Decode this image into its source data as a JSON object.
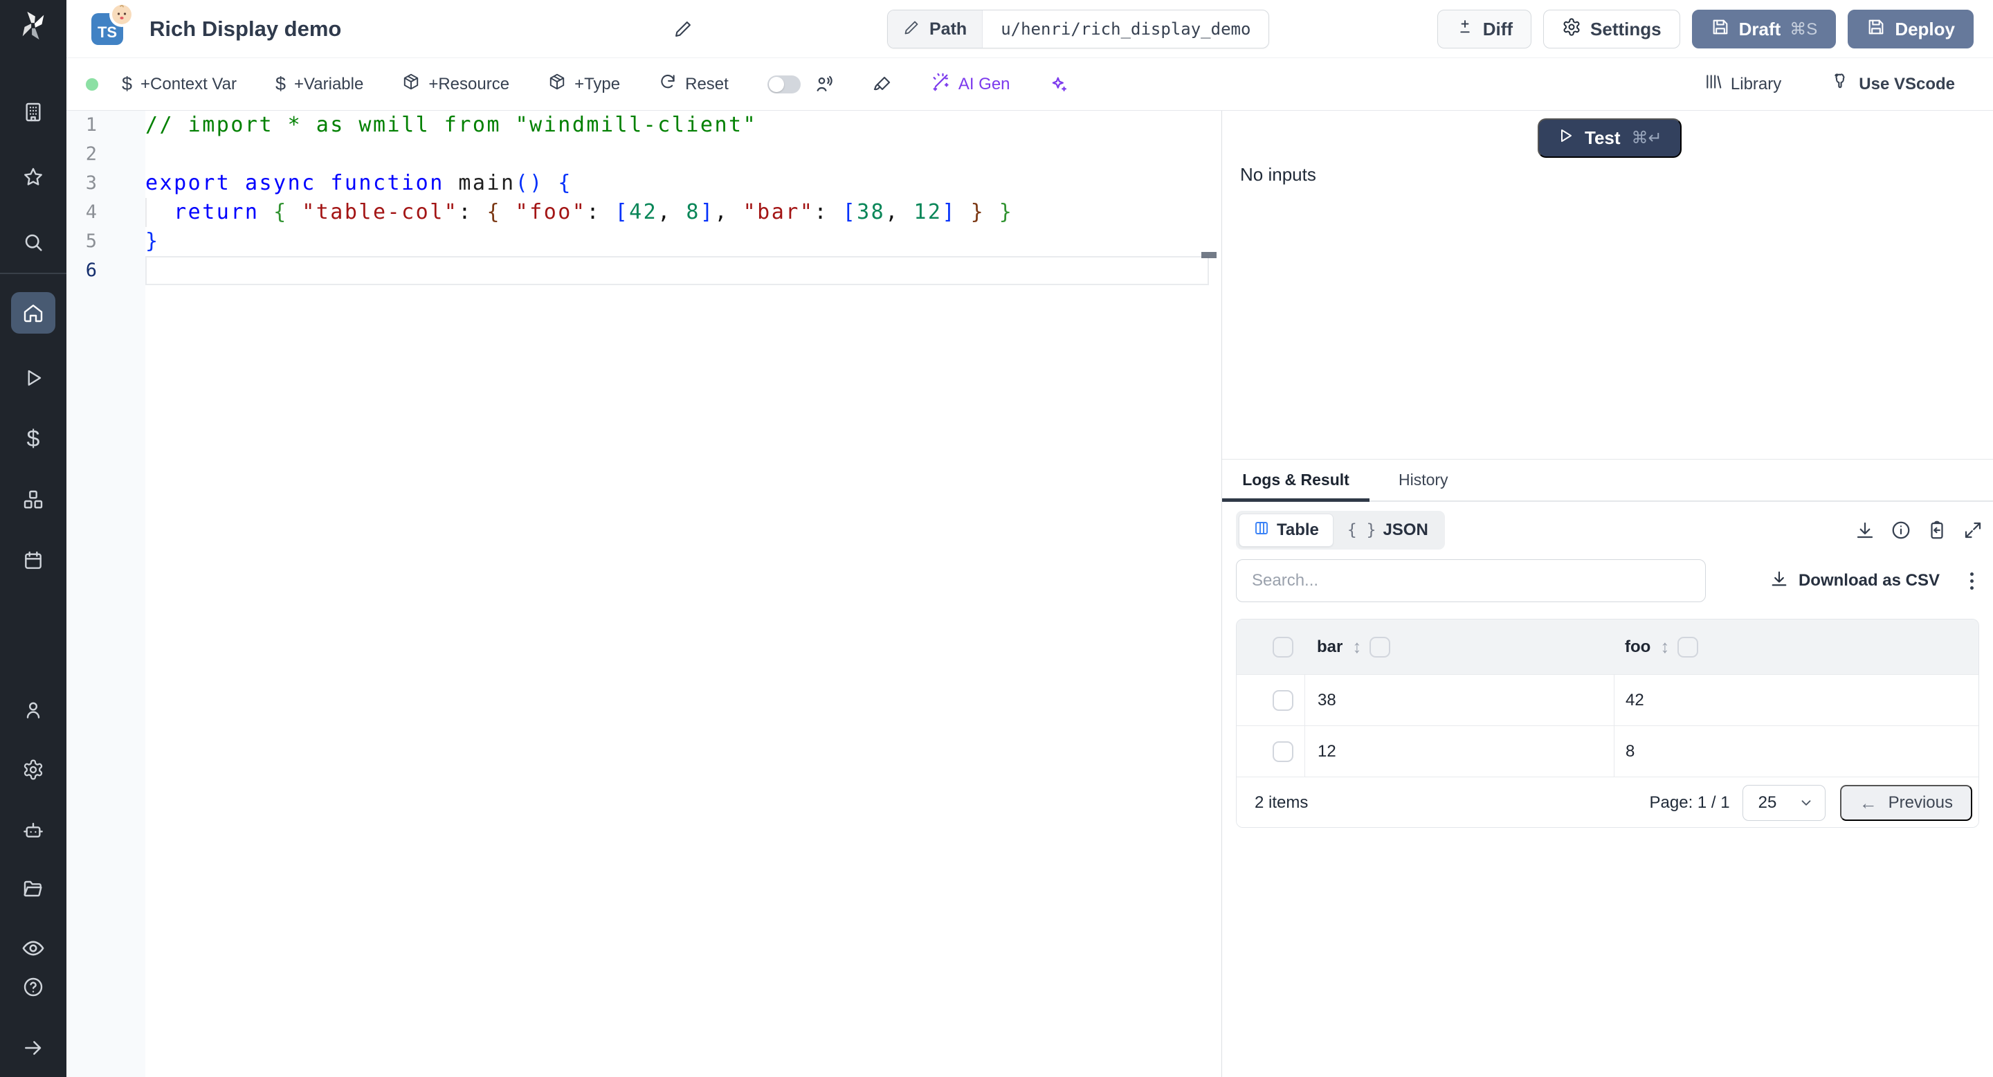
{
  "topbar": {
    "badge": "TS",
    "title": "Rich Display demo",
    "path_label": "Path",
    "path_value": "u/henri/rich_display_demo",
    "diff_label": "Diff",
    "settings_label": "Settings",
    "draft_label": "Draft",
    "draft_shortcut": "⌘S",
    "deploy_label": "Deploy"
  },
  "toolbar": {
    "context_var": "+Context Var",
    "variable": "+Variable",
    "resource": "+Resource",
    "type": "+Type",
    "reset": "Reset",
    "ai_gen": "AI Gen",
    "library": "Library",
    "vscode": "Use VScode"
  },
  "glyphs": {
    "dollar": "$",
    "sort": "↕",
    "arrow_left": "←",
    "braces": "{ }"
  },
  "editor": {
    "lines": [
      {
        "n": "1",
        "tokens": [
          {
            "c": "comment",
            "t": "// import * as wmill from \"windmill-client\""
          }
        ]
      },
      {
        "n": "2",
        "tokens": []
      },
      {
        "n": "3",
        "tokens": [
          {
            "c": "kw",
            "t": "export"
          },
          {
            "c": "plain",
            "t": " "
          },
          {
            "c": "kw",
            "t": "async"
          },
          {
            "c": "plain",
            "t": " "
          },
          {
            "c": "kw",
            "t": "function"
          },
          {
            "c": "plain",
            "t": " "
          },
          {
            "c": "fn",
            "t": "main"
          },
          {
            "c": "b1",
            "t": "()"
          },
          {
            "c": "plain",
            "t": " "
          },
          {
            "c": "b1",
            "t": "{"
          }
        ]
      },
      {
        "n": "4",
        "guide": true,
        "tokens": [
          {
            "c": "plain",
            "t": "  "
          },
          {
            "c": "kw",
            "t": "return"
          },
          {
            "c": "plain",
            "t": " "
          },
          {
            "c": "b2",
            "t": "{"
          },
          {
            "c": "plain",
            "t": " "
          },
          {
            "c": "str",
            "t": "\"table-col\""
          },
          {
            "c": "plain",
            "t": ": "
          },
          {
            "c": "b3",
            "t": "{"
          },
          {
            "c": "plain",
            "t": " "
          },
          {
            "c": "str",
            "t": "\"foo\""
          },
          {
            "c": "plain",
            "t": ": "
          },
          {
            "c": "b1",
            "t": "["
          },
          {
            "c": "num",
            "t": "42"
          },
          {
            "c": "plain",
            "t": ", "
          },
          {
            "c": "num",
            "t": "8"
          },
          {
            "c": "b1",
            "t": "]"
          },
          {
            "c": "plain",
            "t": ", "
          },
          {
            "c": "str",
            "t": "\"bar\""
          },
          {
            "c": "plain",
            "t": ": "
          },
          {
            "c": "b1",
            "t": "["
          },
          {
            "c": "num",
            "t": "38"
          },
          {
            "c": "plain",
            "t": ", "
          },
          {
            "c": "num",
            "t": "12"
          },
          {
            "c": "b1",
            "t": "]"
          },
          {
            "c": "plain",
            "t": " "
          },
          {
            "c": "b3",
            "t": "}"
          },
          {
            "c": "plain",
            "t": " "
          },
          {
            "c": "b2",
            "t": "}"
          }
        ]
      },
      {
        "n": "5",
        "tokens": [
          {
            "c": "b1",
            "t": "}"
          }
        ]
      },
      {
        "n": "6",
        "active": true,
        "tokens": []
      }
    ]
  },
  "run": {
    "test_label": "Test",
    "test_shortcut": "⌘↵",
    "no_inputs": "No inputs"
  },
  "result": {
    "tab_active": "Logs & Result",
    "tab_history": "History",
    "view_table": "Table",
    "view_json": "JSON",
    "search_placeholder": "Search...",
    "download_csv": "Download as CSV",
    "table": {
      "columns": [
        "bar",
        "foo"
      ],
      "rows": [
        [
          "38",
          "42"
        ],
        [
          "12",
          "8"
        ]
      ],
      "items_label": "2 items",
      "page_label": "Page: 1 / 1",
      "page_size": "25",
      "prev_label": "Previous"
    }
  },
  "colors": {
    "accent_slate": "#66799b",
    "test_navy": "#33415e",
    "ai_purple": "#7c3aed",
    "status_green": "#8ce0a4",
    "table_icon_blue": "#3b82f6",
    "sidebar_bg": "#20252c",
    "active_item_bg": "#485a72"
  }
}
